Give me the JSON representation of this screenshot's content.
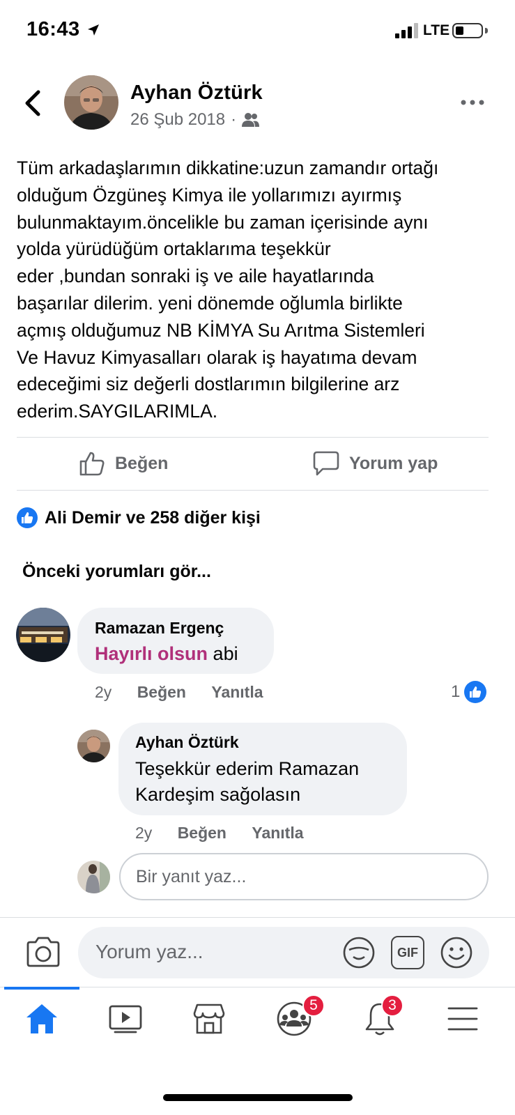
{
  "status_bar": {
    "time": "16:43",
    "network": "LTE",
    "battery_level": 0.25
  },
  "post": {
    "author": "Ayhan Öztürk",
    "date": "26 Şub 2018",
    "separator": "·",
    "audience_icon": "friends-icon",
    "lines": [
      "Tüm arkadaşlarımın dikkatine:uzun zamandır ortağı",
      "olduğum Özgüneş Kimya ile yollarımızı ayırmış",
      "bulunmaktayım.öncelikle bu zaman içerisinde aynı",
      "yolda yürüdüğüm ortaklarıma teşekkür",
      "eder ,bundan sonraki iş ve aile hayatlarında",
      "başarılar dilerim. yeni dönemde oğlumla birlikte",
      "açmış olduğumuz NB KİMYA Su Arıtma Sistemleri",
      "Ve Havuz Kimyasalları olarak iş hayatıma devam",
      "edeceğimi siz değerli dostlarımın bilgilerine arz",
      "ederim.SAYGILARIMLA."
    ]
  },
  "actions": {
    "like": "Beğen",
    "comment": "Yorum yap"
  },
  "reactions": {
    "summary": "Ali Demir ve 258 diğer kişi"
  },
  "comments": {
    "see_previous": "Önceki yorumları gör...",
    "items": [
      {
        "name": "Ramazan Ergenç",
        "text_highlight": "Hayırlı olsun",
        "text_rest": " abi",
        "time": "2y",
        "like": "Beğen",
        "reply": "Yanıtla",
        "like_count": "1"
      }
    ],
    "reply": {
      "name": "Ayhan Öztürk",
      "lines": [
        "Teşekkür ederim Ramazan",
        "Kardeşim sağolasın"
      ],
      "time": "2y",
      "like": "Beğen",
      "reply": "Yanıtla"
    },
    "reply_placeholder": "Bir yanıt yaz..."
  },
  "composer": {
    "placeholder": "Yorum yaz...",
    "gif_label": "GIF"
  },
  "tabs": {
    "items": [
      "home-icon",
      "watch-icon",
      "marketplace-icon",
      "groups-icon",
      "notifications-icon",
      "menu-icon"
    ],
    "groups_badge": "5",
    "notifications_badge": "3"
  },
  "colors": {
    "accent": "#1877f2",
    "highlight_text": "#b0307a",
    "secondary_text": "#65676b",
    "badge": "#e41e3f"
  }
}
